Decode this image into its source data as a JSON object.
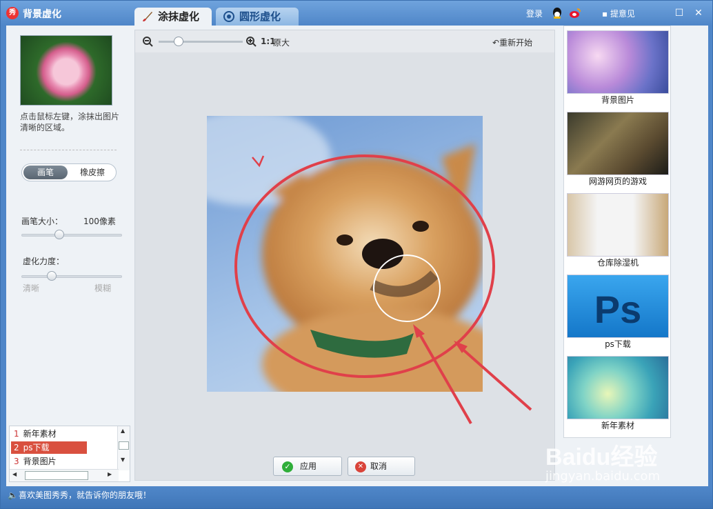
{
  "titlebar": {
    "app_title": "背景虚化",
    "tabs": [
      {
        "label": "涂抹虚化"
      },
      {
        "label": "圆形虚化"
      }
    ],
    "login": "登录",
    "feedback": "提意见"
  },
  "left": {
    "hint": "点击鼠标左键，涂抹出图片清晰的区域。",
    "brush_tab": "画笔",
    "eraser_tab": "橡皮擦",
    "brush_size_label": "画笔大小：",
    "brush_size_value": "100像素",
    "blur_label": "虚化力度：",
    "blur_min": "清晰",
    "blur_max": "模糊",
    "brush_size_level": 0.38,
    "blur_level": 0.3,
    "history": [
      {
        "num": "1",
        "label": "新年素材",
        "selected": false
      },
      {
        "num": "2",
        "label": "ps下载",
        "selected": true
      },
      {
        "num": "3",
        "label": "背景图片",
        "selected": false
      }
    ]
  },
  "canvas": {
    "zoom_ratio": "1:1",
    "zoom_label": "原大",
    "restart": "重新开始",
    "apply": "应用",
    "cancel": "取消"
  },
  "ads": [
    {
      "label": "背景图片"
    },
    {
      "label": "网游网页的游戏"
    },
    {
      "label": "仓库除湿机"
    },
    {
      "label": "ps下载"
    },
    {
      "label": "新年素材"
    }
  ],
  "status": {
    "text": "喜欢美图秀秀，就告诉你的朋友哦！"
  },
  "watermark": {
    "brand": "Baidu经验",
    "url": "jingyan.baidu.com"
  },
  "colors": {
    "accent": "#4f86c8",
    "annotation": "#e0404a",
    "selected_row": "#d9503f"
  }
}
